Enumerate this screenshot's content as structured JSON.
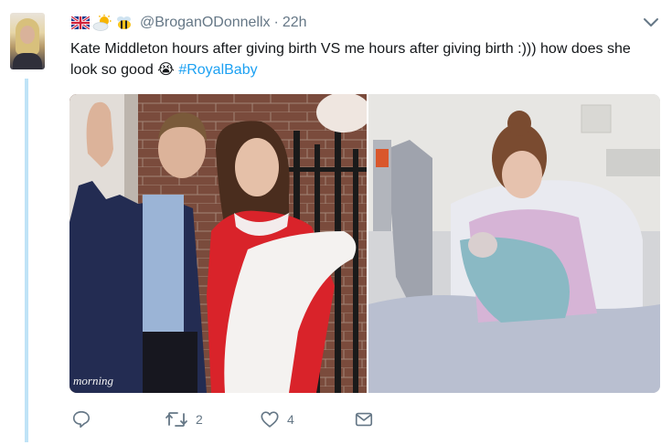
{
  "tweet": {
    "header": {
      "handle": "@BroganODonnellx",
      "separator": "·",
      "time": "22h",
      "emojis": [
        "uk-flag-icon",
        "sun-behind-cloud-icon",
        "bee-icon"
      ]
    },
    "text_main": "Kate Middleton hours after giving birth VS me hours after giving birth :))) how does she look so good 😭 ",
    "hashtag": "#RoyalBaby",
    "media": {
      "watermark": "morning"
    },
    "actions": {
      "reply_count": "",
      "retweet_count": "2",
      "like_count": "4"
    }
  },
  "colors": {
    "link": "#1da1f2",
    "muted": "#657786",
    "thread_line": "#bfe3f7"
  }
}
